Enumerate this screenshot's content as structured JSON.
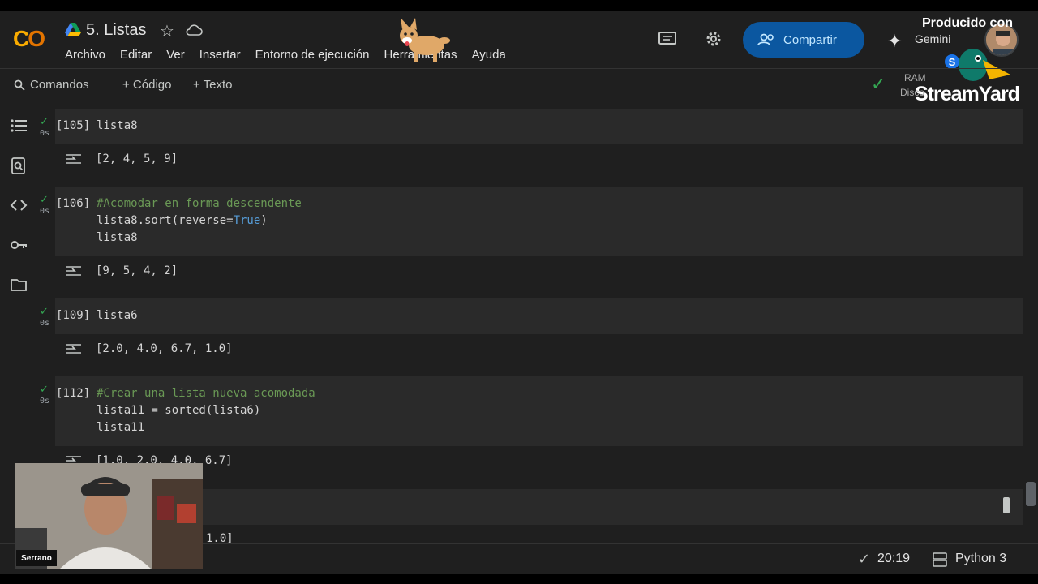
{
  "header": {
    "logo": "CO",
    "title": "5. Listas",
    "menu": [
      "Archivo",
      "Editar",
      "Ver",
      "Insertar",
      "Entorno de ejecución",
      "Herramientas",
      "Ayuda"
    ],
    "share_label": "Compartir",
    "gemini_label": "Gemini"
  },
  "overlay": {
    "producido": "Producido con",
    "brand": "StreamYard",
    "webcam_name": "Serrano"
  },
  "toolbar": {
    "commands": "Comandos",
    "add_code": "+ Código",
    "add_text": "+ Texto",
    "ram": "RAM",
    "disk": "Disco"
  },
  "cells": [
    {
      "num": "[105]",
      "time": "0s",
      "lines": [
        "lista8"
      ],
      "output": "[2, 4, 5, 9]"
    },
    {
      "num": "[106]",
      "time": "0s",
      "comment": "#Acomodar en forma descendente",
      "line2a": "lista8.sort(reverse=",
      "line2kw": "True",
      "line2b": ")",
      "line3": "lista8",
      "output": "[9, 5, 4, 2]"
    },
    {
      "num": "[109]",
      "time": "0s",
      "lines": [
        "lista6"
      ],
      "output": "[2.0, 4.0, 6.7, 1.0]"
    },
    {
      "num": "[112]",
      "time": "0s",
      "comment": "#Crear una lista nueva acomodada",
      "line2": "lista11 = sorted(lista6)",
      "line3": "lista11",
      "output": "[1.0, 2.0, 4.0, 6.7]"
    }
  ],
  "partial_output": "1.0]",
  "status": {
    "time": "20:19",
    "runtime": "Python 3"
  },
  "colors": {
    "background": "#1f1f1f",
    "cell": "#2a2a2a",
    "share": "#0b57a0",
    "comment": "#6a9955",
    "keyword": "#569cd6",
    "check": "#34a853"
  }
}
